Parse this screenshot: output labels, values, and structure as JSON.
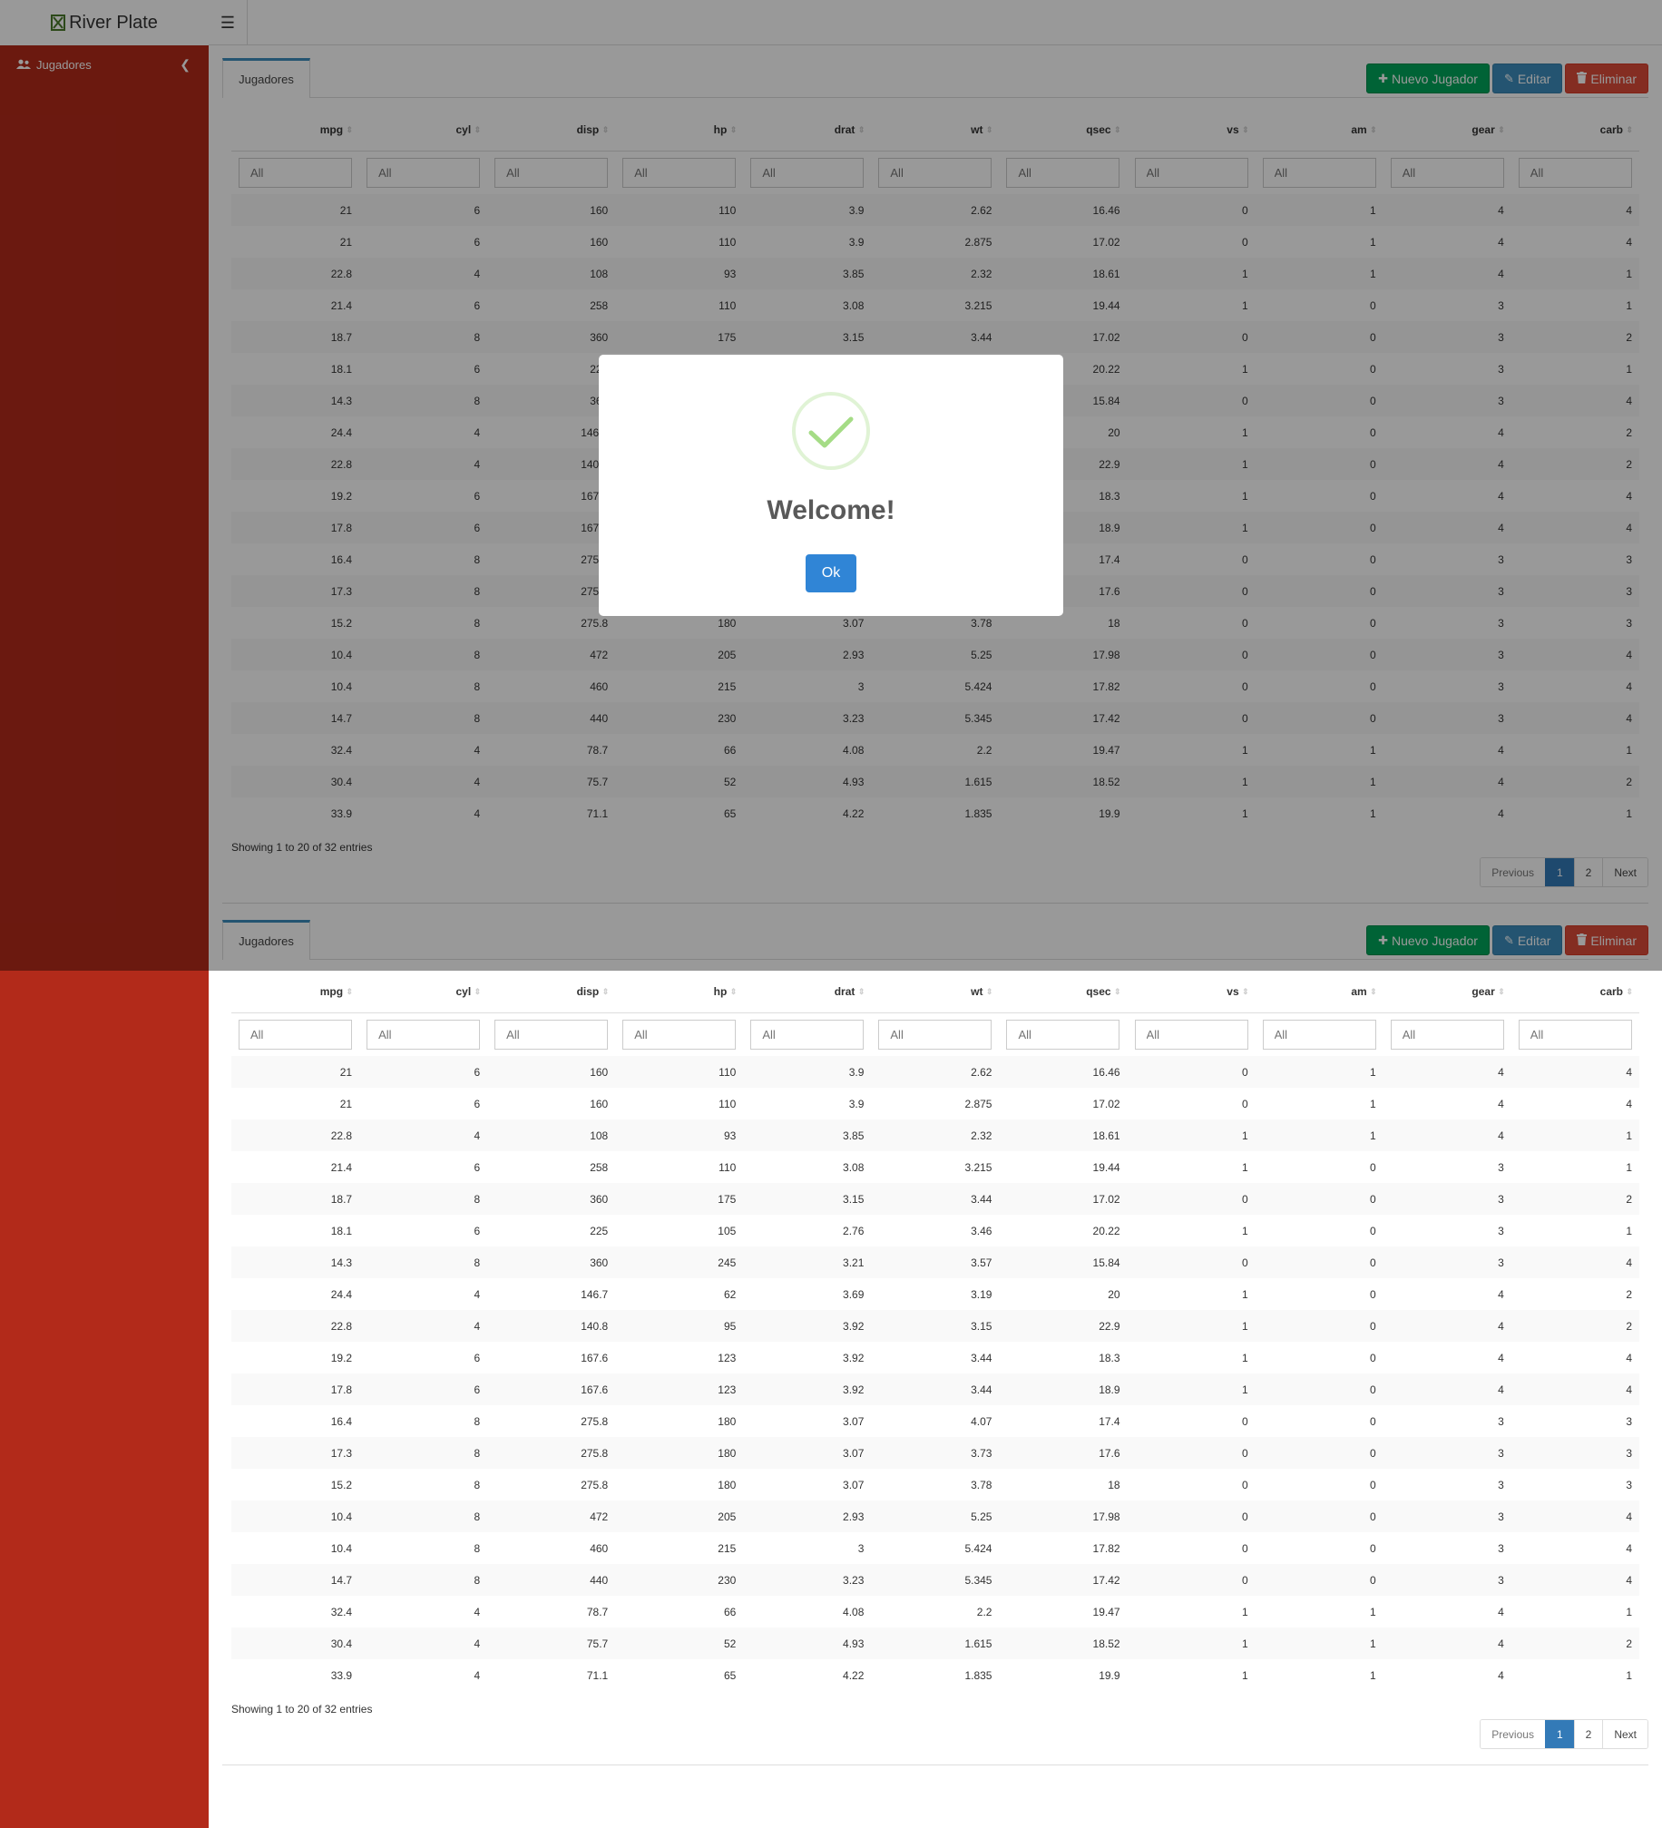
{
  "brand": {
    "name": "River Plate",
    "icon": "hourglass-icon"
  },
  "sidebar": {
    "items": [
      {
        "label": "Jugadores",
        "icon": "users-icon"
      }
    ]
  },
  "colors": {
    "sidebar": "#b22a1a",
    "success": "#00a65a",
    "primary": "#3c8dbc",
    "danger": "#dd4b39",
    "check": "#a5dc86",
    "ok_button": "#3085d6"
  },
  "panels": [
    {
      "tab": "Jugadores",
      "buttons": {
        "new": "Nuevo Jugador",
        "edit": "Editar",
        "delete": "Eliminar"
      }
    },
    {
      "tab": "Jugadores",
      "buttons": {
        "new": "Nuevo Jugador",
        "edit": "Editar",
        "delete": "Eliminar"
      }
    }
  ],
  "table": {
    "columns": [
      "mpg",
      "cyl",
      "disp",
      "hp",
      "drat",
      "wt",
      "qsec",
      "vs",
      "am",
      "gear",
      "carb"
    ],
    "filter_placeholder": "All",
    "rows": [
      [
        "21",
        "6",
        "160",
        "110",
        "3.9",
        "2.62",
        "16.46",
        "0",
        "1",
        "4",
        "4"
      ],
      [
        "21",
        "6",
        "160",
        "110",
        "3.9",
        "2.875",
        "17.02",
        "0",
        "1",
        "4",
        "4"
      ],
      [
        "22.8",
        "4",
        "108",
        "93",
        "3.85",
        "2.32",
        "18.61",
        "1",
        "1",
        "4",
        "1"
      ],
      [
        "21.4",
        "6",
        "258",
        "110",
        "3.08",
        "3.215",
        "19.44",
        "1",
        "0",
        "3",
        "1"
      ],
      [
        "18.7",
        "8",
        "360",
        "175",
        "3.15",
        "3.44",
        "17.02",
        "0",
        "0",
        "3",
        "2"
      ],
      [
        "18.1",
        "6",
        "225",
        "105",
        "2.76",
        "3.46",
        "20.22",
        "1",
        "0",
        "3",
        "1"
      ],
      [
        "14.3",
        "8",
        "360",
        "245",
        "3.21",
        "3.57",
        "15.84",
        "0",
        "0",
        "3",
        "4"
      ],
      [
        "24.4",
        "4",
        "146.7",
        "62",
        "3.69",
        "3.19",
        "20",
        "1",
        "0",
        "4",
        "2"
      ],
      [
        "22.8",
        "4",
        "140.8",
        "95",
        "3.92",
        "3.15",
        "22.9",
        "1",
        "0",
        "4",
        "2"
      ],
      [
        "19.2",
        "6",
        "167.6",
        "123",
        "3.92",
        "3.44",
        "18.3",
        "1",
        "0",
        "4",
        "4"
      ],
      [
        "17.8",
        "6",
        "167.6",
        "123",
        "3.92",
        "3.44",
        "18.9",
        "1",
        "0",
        "4",
        "4"
      ],
      [
        "16.4",
        "8",
        "275.8",
        "180",
        "3.07",
        "4.07",
        "17.4",
        "0",
        "0",
        "3",
        "3"
      ],
      [
        "17.3",
        "8",
        "275.8",
        "180",
        "3.07",
        "3.73",
        "17.6",
        "0",
        "0",
        "3",
        "3"
      ],
      [
        "15.2",
        "8",
        "275.8",
        "180",
        "3.07",
        "3.78",
        "18",
        "0",
        "0",
        "3",
        "3"
      ],
      [
        "10.4",
        "8",
        "472",
        "205",
        "2.93",
        "5.25",
        "17.98",
        "0",
        "0",
        "3",
        "4"
      ],
      [
        "10.4",
        "8",
        "460",
        "215",
        "3",
        "5.424",
        "17.82",
        "0",
        "0",
        "3",
        "4"
      ],
      [
        "14.7",
        "8",
        "440",
        "230",
        "3.23",
        "5.345",
        "17.42",
        "0",
        "0",
        "3",
        "4"
      ],
      [
        "32.4",
        "4",
        "78.7",
        "66",
        "4.08",
        "2.2",
        "19.47",
        "1",
        "1",
        "4",
        "1"
      ],
      [
        "30.4",
        "4",
        "75.7",
        "52",
        "4.93",
        "1.615",
        "18.52",
        "1",
        "1",
        "4",
        "2"
      ],
      [
        "33.9",
        "4",
        "71.1",
        "65",
        "4.22",
        "1.835",
        "19.9",
        "1",
        "1",
        "4",
        "1"
      ]
    ],
    "info": "Showing 1 to 20 of 32 entries",
    "pagination": {
      "previous": "Previous",
      "pages": [
        "1",
        "2"
      ],
      "active": "1",
      "next": "Next"
    }
  },
  "modal": {
    "title": "Welcome!",
    "ok": "Ok",
    "icon": "success-check-icon"
  }
}
